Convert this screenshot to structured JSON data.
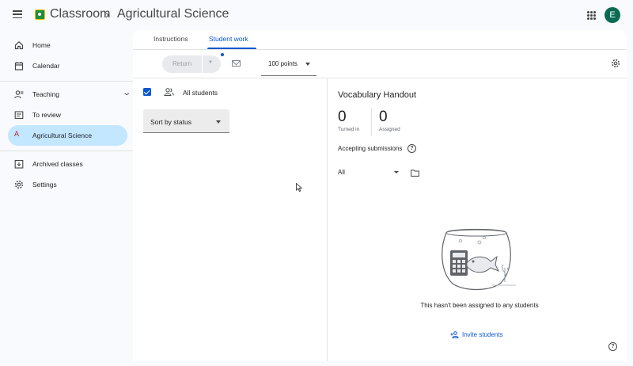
{
  "header": {
    "app_name": "Classroom",
    "breadcrumb_separator": "›",
    "class_name": "Agricultural Science",
    "avatar_initial": "E"
  },
  "sidebar": {
    "items": [
      {
        "label": "Home",
        "icon": "home-icon"
      },
      {
        "label": "Calendar",
        "icon": "calendar-icon"
      },
      {
        "label": "Teaching",
        "icon": "teaching-icon",
        "expanded": true
      },
      {
        "label": "To review",
        "icon": "to-review-icon"
      },
      {
        "label": "Agricultural Science",
        "icon": "class-avatar-icon",
        "initial": "A",
        "active": true
      },
      {
        "label": "Archived classes",
        "icon": "archive-icon"
      },
      {
        "label": "Settings",
        "icon": "gear-icon"
      }
    ]
  },
  "tabs": [
    {
      "label": "Instructions",
      "active": false
    },
    {
      "label": "Student work",
      "active": true
    }
  ],
  "toolbar": {
    "return_label": "Return",
    "points_value": "100 points"
  },
  "students": {
    "all_students_label": "All students",
    "all_selected": true,
    "sort_value": "Sort by status"
  },
  "assignment": {
    "title": "Vocabulary Handout",
    "turned_in_count": "0",
    "turned_in_label": "Turned in",
    "assigned_count": "0",
    "assigned_label": "Assigned",
    "accepting_label": "Accepting submissions",
    "filter_value": "All",
    "empty_message": "This hasn't been assigned to any students",
    "invite_label": "Invite students"
  },
  "colors": {
    "accent": "#0b57d0",
    "active_nav": "#c2e7ff",
    "avatar": "#0b6b52"
  }
}
